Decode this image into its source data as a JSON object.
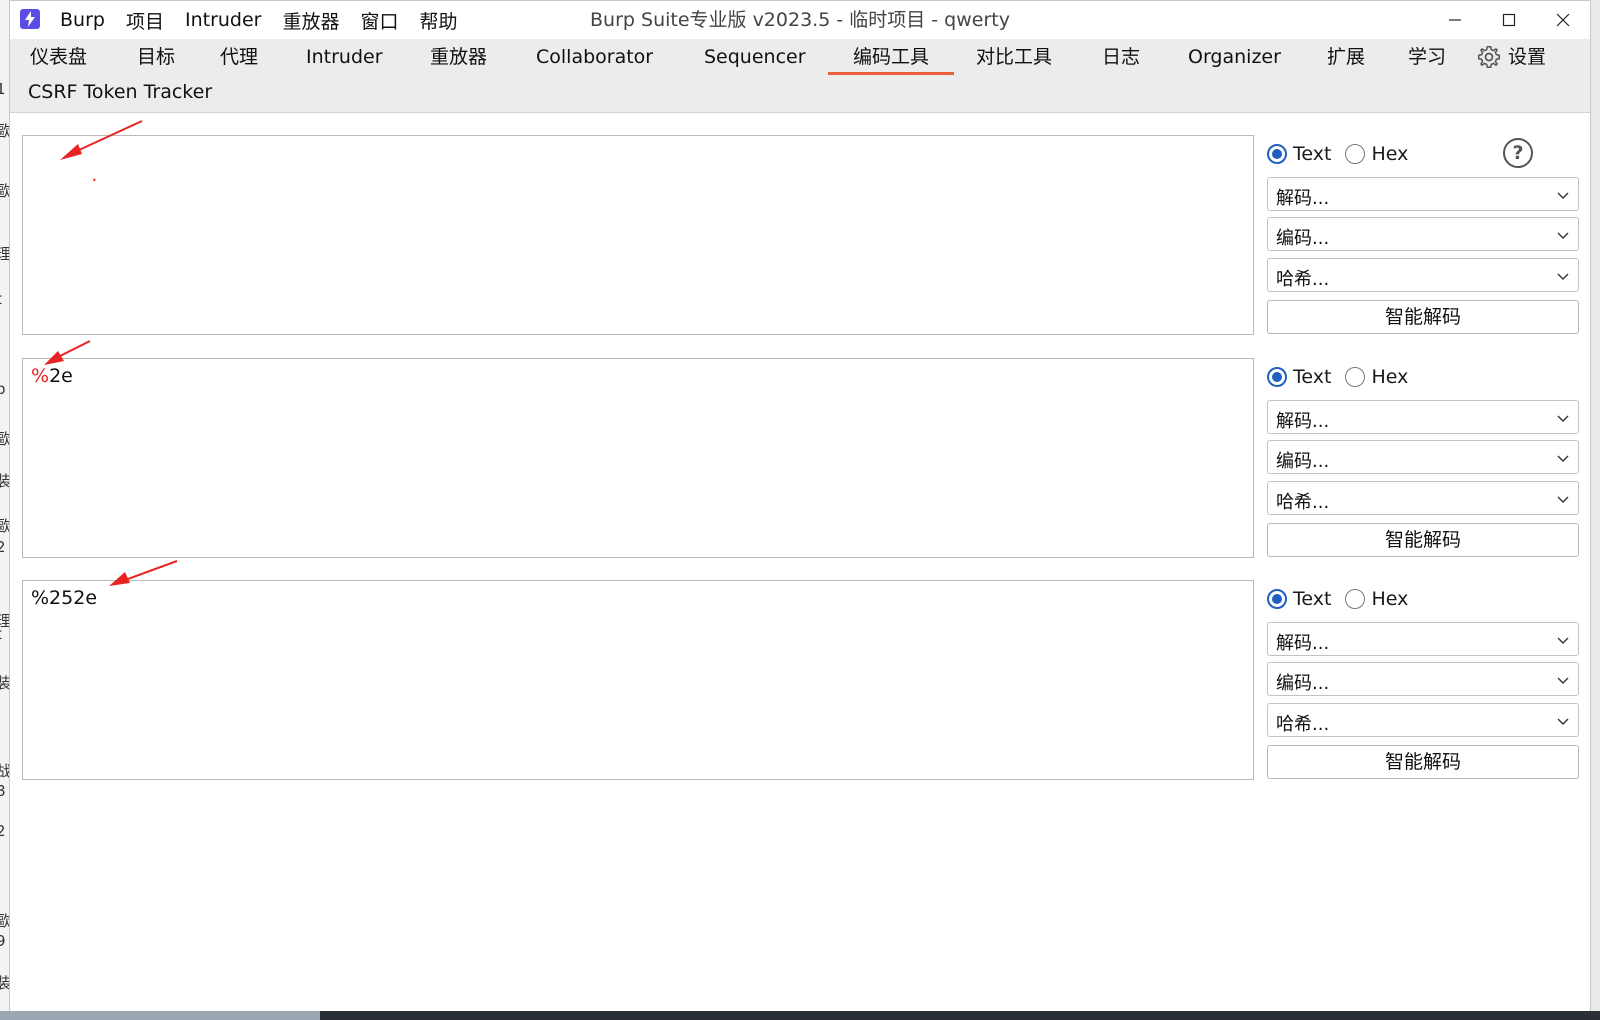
{
  "app": {
    "menu": [
      "Burp",
      "项目",
      "Intruder",
      "重放器",
      "窗口",
      "帮助"
    ],
    "window_title": "Burp Suite专业版  v2023.5 - 临时项目 - qwerty"
  },
  "tabs": {
    "items": [
      "仪表盘",
      "目标",
      "代理",
      "Intruder",
      "重放器",
      "Collaborator",
      "Sequencer",
      "编码工具",
      "对比工具",
      "日志",
      "Organizer",
      "扩展",
      "学习"
    ],
    "settings_label": "设置",
    "second_row": "CSRF Token Tracker",
    "active": "编码工具"
  },
  "panels": [
    {
      "text": ".",
      "text_color": "#e82323",
      "text_label": "Text",
      "hex_label": "Hex",
      "selected": "Text",
      "decode_label": "解码...",
      "encode_label": "编码...",
      "hash_label": "哈希...",
      "smart_decode_label": "智能解码"
    },
    {
      "text_red": "%",
      "text": "2e",
      "text_label": "Text",
      "hex_label": "Hex",
      "selected": "Text",
      "decode_label": "解码...",
      "encode_label": "编码...",
      "hash_label": "哈希...",
      "smart_decode_label": "智能解码"
    },
    {
      "text": "%252e",
      "text_label": "Text",
      "hex_label": "Hex",
      "selected": "Text",
      "decode_label": "解码...",
      "encode_label": "编码...",
      "hash_label": "哈希...",
      "smart_decode_label": "智能解码"
    }
  ],
  "colors": {
    "accent_tab": "#e8603c",
    "radio_checked": "#1f5fbf",
    "annotation_arrow": "#e82323",
    "logo": "#5b4ce6"
  },
  "icons": {
    "logo": "burp-lightning-icon",
    "help": "help-circle-icon",
    "settings": "gear-icon",
    "dropdown": "chevron-down-icon"
  }
}
